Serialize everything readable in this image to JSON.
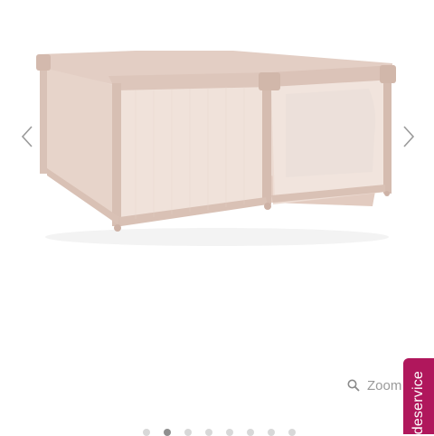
{
  "gallery": {
    "image": {
      "subject": "playpen",
      "frame_color": "#e5d2c9",
      "mesh_color": "#efe0d8"
    },
    "prev_icon": "chevron-left-icon",
    "next_icon": "chevron-right-icon",
    "zoom": {
      "icon": "magnifier-icon",
      "label": "Zoom"
    },
    "dots": {
      "count": 8,
      "active_index": 1
    }
  },
  "service_tab": {
    "label": "deservice",
    "color": "#b0175c"
  }
}
